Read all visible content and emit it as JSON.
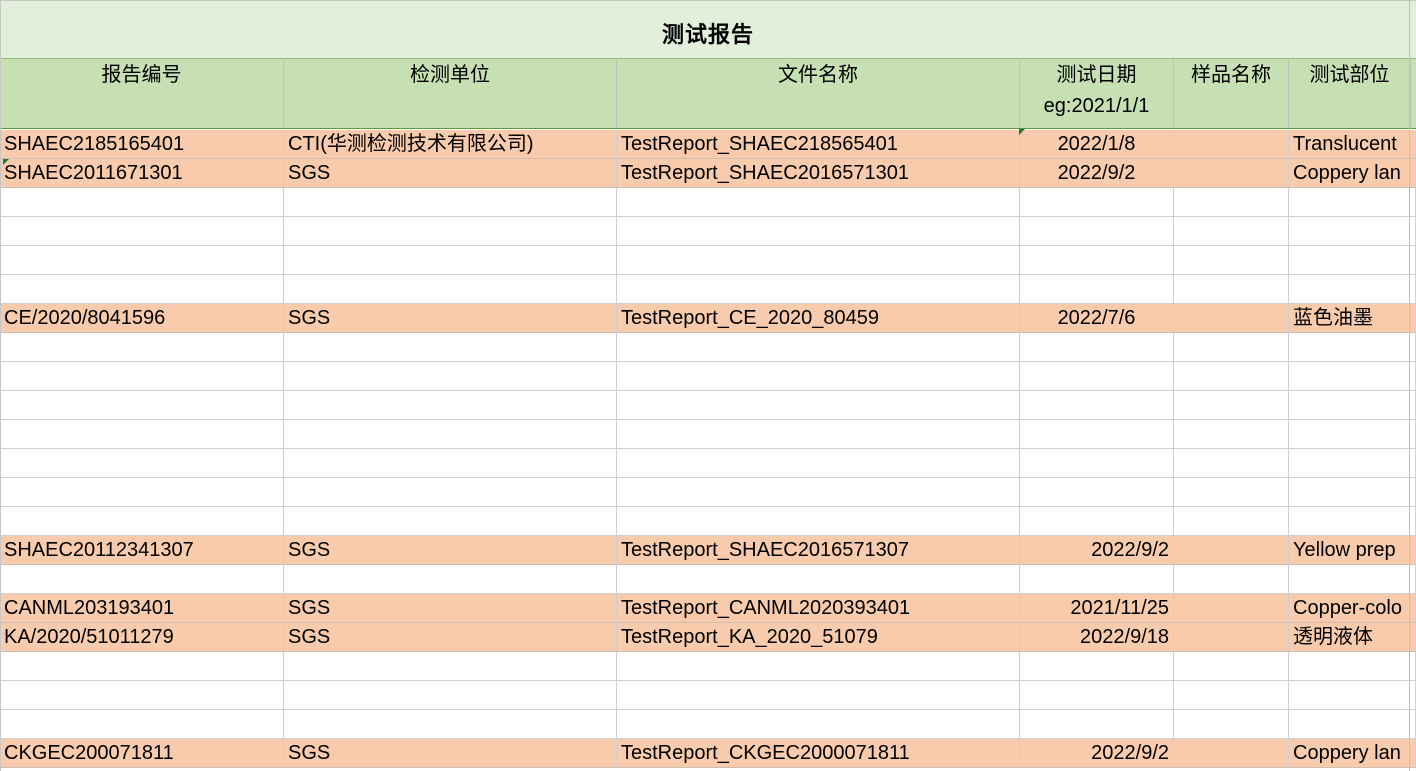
{
  "title": "测试报告",
  "headers": {
    "report_no": "报告编号",
    "lab": "检测单位",
    "file_name": "文件名称",
    "test_date_line1": "测试日期",
    "test_date_line2": "eg:2021/1/1",
    "sample_name": "样品名称",
    "test_part": "测试部位"
  },
  "rows": [
    {
      "report_no": "SHAEC2185165401",
      "lab": "CTI(华测检测技术有限公司)",
      "file_name": "TestReport_SHAEC218565401",
      "test_date": "2022/1/8",
      "sample_name": "",
      "test_part": "Translucent"
    },
    {
      "report_no": " SHAEC2011671301",
      "lab": "SGS",
      "file_name": "TestReport_SHAEC2016571301",
      "test_date": "2022/9/2",
      "sample_name": "",
      "test_part": "Coppery lan"
    },
    {
      "report_no": "",
      "lab": "",
      "file_name": "",
      "test_date": "",
      "sample_name": "",
      "test_part": ""
    },
    {
      "report_no": "",
      "lab": "",
      "file_name": "",
      "test_date": "",
      "sample_name": "",
      "test_part": ""
    },
    {
      "report_no": "",
      "lab": "",
      "file_name": "",
      "test_date": "",
      "sample_name": "",
      "test_part": ""
    },
    {
      "report_no": "",
      "lab": "",
      "file_name": "",
      "test_date": "",
      "sample_name": "",
      "test_part": ""
    },
    {
      "report_no": "CE/2020/8041596",
      "lab": "SGS",
      "file_name": "TestReport_CE_2020_80459",
      "test_date": "2022/7/6",
      "sample_name": "",
      "test_part": "蓝色油墨"
    },
    {
      "report_no": "",
      "lab": "",
      "file_name": "",
      "test_date": "",
      "sample_name": "",
      "test_part": ""
    },
    {
      "report_no": "",
      "lab": "",
      "file_name": "",
      "test_date": "",
      "sample_name": "",
      "test_part": ""
    },
    {
      "report_no": "",
      "lab": "",
      "file_name": "",
      "test_date": "",
      "sample_name": "",
      "test_part": ""
    },
    {
      "report_no": "",
      "lab": "",
      "file_name": "",
      "test_date": "",
      "sample_name": "",
      "test_part": ""
    },
    {
      "report_no": "",
      "lab": "",
      "file_name": "",
      "test_date": "",
      "sample_name": "",
      "test_part": ""
    },
    {
      "report_no": "",
      "lab": "",
      "file_name": "",
      "test_date": "",
      "sample_name": "",
      "test_part": ""
    },
    {
      "report_no": "",
      "lab": "",
      "file_name": "",
      "test_date": "",
      "sample_name": "",
      "test_part": ""
    },
    {
      "report_no": "SHAEC20112341307",
      "lab": "SGS",
      "file_name": "TestReport_SHAEC2016571307",
      "test_date": "2022/9/2",
      "sample_name": "",
      "test_part": "Yellow prep"
    },
    {
      "report_no": "",
      "lab": "",
      "file_name": "",
      "test_date": "",
      "sample_name": "",
      "test_part": ""
    },
    {
      "report_no": "CANML203193401",
      "lab": "SGS",
      "file_name": "TestReport_CANML2020393401",
      "test_date": "2021/11/25",
      "sample_name": "",
      "test_part": "Copper-colo"
    },
    {
      "report_no": "KA/2020/51011279",
      "lab": "SGS",
      "file_name": "TestReport_KA_2020_51079",
      "test_date": "2022/9/18",
      "sample_name": "",
      "test_part": "透明液体"
    },
    {
      "report_no": "",
      "lab": "",
      "file_name": "",
      "test_date": "",
      "sample_name": "",
      "test_part": ""
    },
    {
      "report_no": "",
      "lab": "",
      "file_name": "",
      "test_date": "",
      "sample_name": "",
      "test_part": ""
    },
    {
      "report_no": "",
      "lab": "",
      "file_name": "",
      "test_date": "",
      "sample_name": "",
      "test_part": ""
    },
    {
      "report_no": "CKGEC200071811",
      "lab": "SGS",
      "file_name": "TestReport_CKGEC2000071811",
      "test_date": "2022/9/2",
      "sample_name": "",
      "test_part": "Coppery lan"
    }
  ],
  "colors": {
    "title_bg": "#e2efda",
    "header_bg": "#c6e0b4",
    "filled_row_bg": "#f8cbad"
  }
}
